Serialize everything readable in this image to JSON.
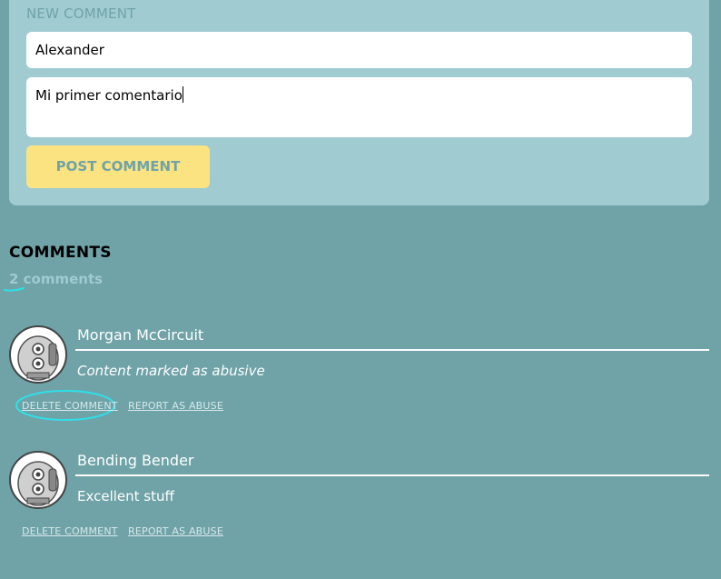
{
  "form": {
    "label": "NEW COMMENT",
    "name_value": "Alexander",
    "comment_value": "Mi primer comentario",
    "post_label": "POST COMMENT"
  },
  "comments_section": {
    "title": "COMMENTS",
    "count_text": "2 comments"
  },
  "comments": [
    {
      "author": "Morgan McCircuit",
      "body": "Content marked as abusive",
      "delete_label": "DELETE COMMENT",
      "report_label": "REPORT AS ABUSE",
      "avatar_icon": "robot-avatar-icon"
    },
    {
      "author": "Bending Bender",
      "body": "Excellent stuff",
      "delete_label": "DELETE COMMENT",
      "report_label": "REPORT AS ABUSE",
      "avatar_icon": "robot-avatar-icon"
    }
  ],
  "colors": {
    "background": "#6fa3a8",
    "panel": "#a0cbd1",
    "button": "#fbe382",
    "highlight": "#2ee0e8"
  }
}
